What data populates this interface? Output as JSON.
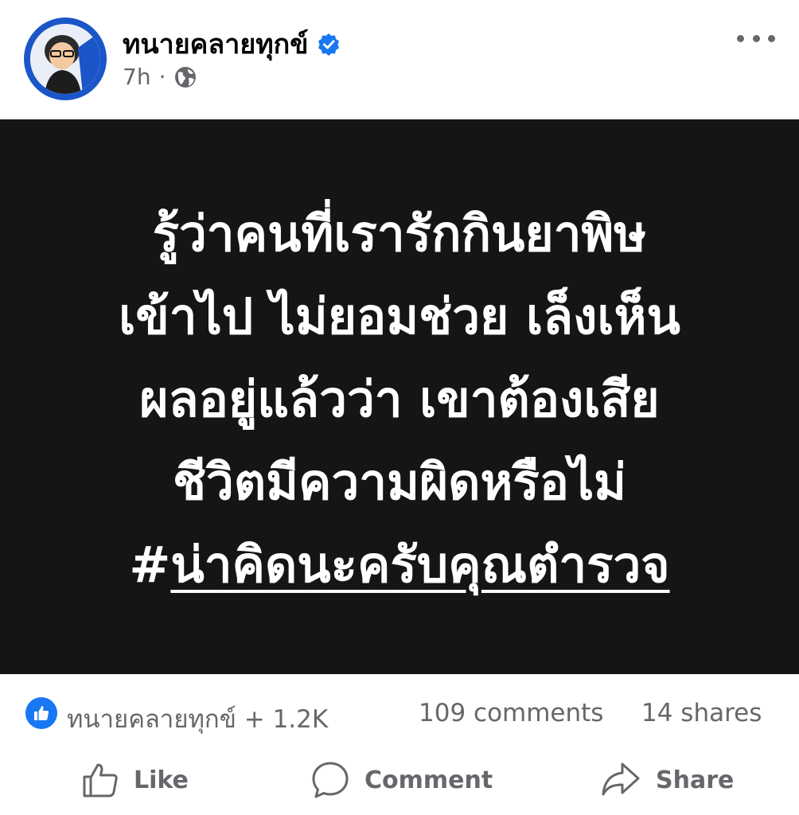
{
  "post": {
    "author": "ทนายคลายทุกข์",
    "time": "7h",
    "separator": "·",
    "audience_icon": "globe-icon",
    "verified_icon": "verified-badge-icon",
    "avatar_text": "ทนายคลายทุกข์"
  },
  "image_text": {
    "line1": "รู้ว่าคนที่เรารักกินยาพิษ",
    "line2": "เข้าไป ไม่ยอมช่วย เล็งเห็น",
    "line3": "ผลอยู่แล้วว่า เขาต้องเสีย",
    "line4": "ชีวิตมีความผิดหรือไม่",
    "hash_symbol": "#",
    "hashtag": "น่าคิดนะครับคุณตำรวจ"
  },
  "stats": {
    "reactors": "ทนายคลายทุกข์ + 1.2K",
    "comments": "109 comments",
    "shares": "14 shares"
  },
  "actions": {
    "like": "Like",
    "comment": "Comment",
    "share": "Share"
  },
  "colors": {
    "brand_blue": "#1877f2",
    "avatar_ring": "#1a56c8",
    "image_bg": "#151515",
    "secondary_text": "#65676b"
  }
}
